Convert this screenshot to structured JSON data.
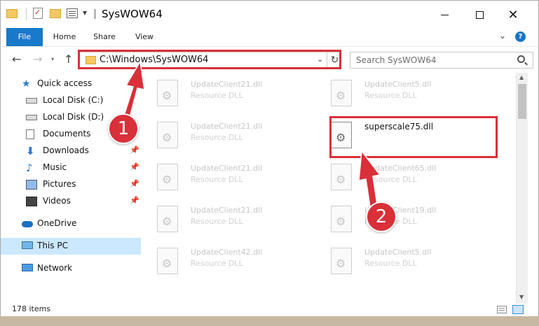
{
  "window": {
    "title": "SysWOW64",
    "close_glyph": "✕"
  },
  "ribbon": {
    "tabs": [
      "File",
      "Home",
      "Share",
      "View"
    ],
    "help": "?",
    "chevron": "⌄"
  },
  "nav": {
    "back": "←",
    "forward": "→",
    "recent": "▾",
    "up": "↑",
    "address": "C:\\Windows\\SysWOW64",
    "address_dropdown": "⌄",
    "refresh": "↻",
    "search_placeholder": "Search SysWOW64"
  },
  "sidebar": {
    "items": [
      {
        "label": "Quick access",
        "icon": "star-icon",
        "pinned": false
      },
      {
        "label": "Local Disk (C:)",
        "icon": "disk-icon",
        "pinned": false
      },
      {
        "label": "Local Disk (D:)",
        "icon": "disk-icon",
        "pinned": false
      },
      {
        "label": "Documents",
        "icon": "document-icon",
        "pinned": false
      },
      {
        "label": "Downloads",
        "icon": "download-icon",
        "pinned": true
      },
      {
        "label": "Music",
        "icon": "music-icon",
        "pinned": true
      },
      {
        "label": "Pictures",
        "icon": "pictures-icon",
        "pinned": true
      },
      {
        "label": "Videos",
        "icon": "videos-icon",
        "pinned": true
      },
      {
        "label": "OneDrive",
        "icon": "onedrive-icon",
        "pinned": false
      },
      {
        "label": "This PC",
        "icon": "this-pc-icon",
        "pinned": false,
        "selected": true
      },
      {
        "label": "Network",
        "icon": "network-icon",
        "pinned": false
      }
    ],
    "pin_glyph": "📌"
  },
  "files": {
    "left_column": [
      {
        "name": "UpdateClient21.dll",
        "type": "Resource DLL"
      },
      {
        "name": "UpdateClient21.dll",
        "type": "Resource DLL"
      },
      {
        "name": "UpdateClient21.dll",
        "type": "Resource DLL"
      },
      {
        "name": "UpdateClient21.dll",
        "type": "Resource DLL"
      },
      {
        "name": "UpdateClient42.dll",
        "type": "Resource DLL"
      }
    ],
    "right_column": [
      {
        "name": "UpdateClient5.dll",
        "type": "Resource DLL"
      },
      {
        "name": "superscale75.dll",
        "type": ""
      },
      {
        "name": "UpdateClient65.dll",
        "type": "Resource DLL"
      },
      {
        "name": "UpdateClient19.dll",
        "type": "Resource DLL"
      },
      {
        "name": "UpdateClient5.dll",
        "type": "Resource DLL"
      }
    ]
  },
  "scrollbar": {
    "up": "▲",
    "down": "▼"
  },
  "status": {
    "items_count": "178 items"
  },
  "annotations": {
    "badge1": "1",
    "badge2": "2"
  },
  "colors": {
    "accent": "#1979ca",
    "annotation_red": "#d9303a",
    "selection": "#cce8ff"
  }
}
